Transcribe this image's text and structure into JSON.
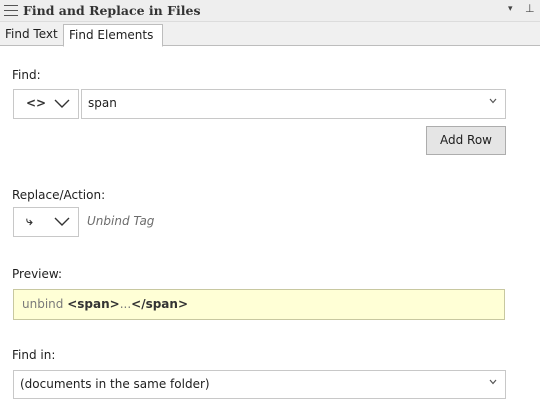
{
  "panel": {
    "title": "Find and Replace in Files",
    "dropdown_glyph": "▾",
    "pin_glyph": "⊥"
  },
  "tabs": [
    {
      "label": "Find Text",
      "active": false
    },
    {
      "label": "Find Elements",
      "active": true
    }
  ],
  "find": {
    "label": "Find:",
    "mode_icon": "<>",
    "value": "span"
  },
  "add_row": {
    "label": "Add Row"
  },
  "replace": {
    "label": "Replace/Action:",
    "mode_icon": "⤷",
    "value": "Unbind Tag"
  },
  "preview": {
    "label": "Preview:",
    "prefix": "unbind ",
    "open_tag": "<span>",
    "middle": "...",
    "close_tag": "</span>"
  },
  "find_in": {
    "label": "Find in:",
    "value": "(documents in the same folder)"
  }
}
